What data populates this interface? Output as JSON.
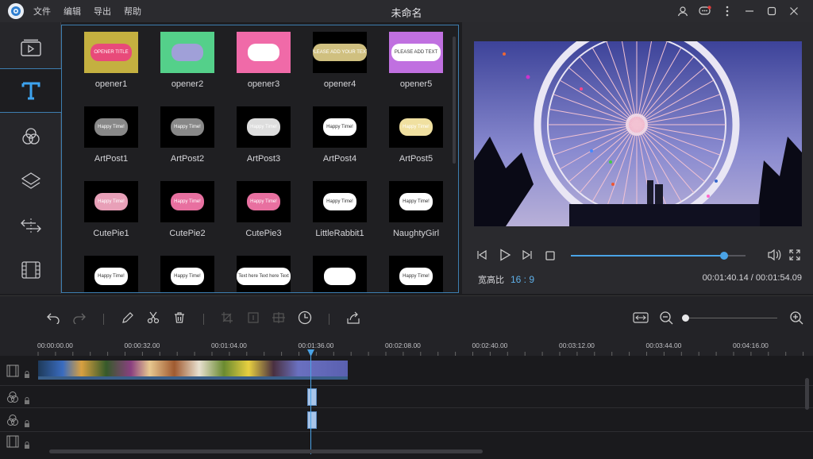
{
  "window": {
    "title": "未命名"
  },
  "menu": [
    "文件",
    "编辑",
    "导出",
    "帮助"
  ],
  "library": {
    "items": [
      {
        "label": "opener1",
        "thumb_text": "OPENER TITLE"
      },
      {
        "label": "opener2",
        "thumb_text": ""
      },
      {
        "label": "opener3",
        "thumb_text": ""
      },
      {
        "label": "opener4",
        "thumb_text": "PLEASE ADD YOUR TEXT"
      },
      {
        "label": "opener5",
        "thumb_text": "PLEASE ADD TEXT"
      },
      {
        "label": "ArtPost1",
        "thumb_text": "Happy Time!"
      },
      {
        "label": "ArtPost2",
        "thumb_text": "Happy Time!"
      },
      {
        "label": "ArtPost3",
        "thumb_text": "Happy Time!"
      },
      {
        "label": "ArtPost4",
        "thumb_text": "Happy Time!"
      },
      {
        "label": "ArtPost5",
        "thumb_text": "Happy Time!"
      },
      {
        "label": "CutePie1",
        "thumb_text": "Happy Time!"
      },
      {
        "label": "CutePie2",
        "thumb_text": "Happy Time!"
      },
      {
        "label": "CutePie3",
        "thumb_text": "Happy Time!"
      },
      {
        "label": "LittleRabbit1",
        "thumb_text": "Happy Time!"
      },
      {
        "label": "NaughtyGirl",
        "thumb_text": "Happy Time!"
      },
      {
        "label": "",
        "thumb_text": "Happy Time!"
      },
      {
        "label": "",
        "thumb_text": "Happy Time!"
      },
      {
        "label": "",
        "thumb_text": "Text here Text here Text"
      },
      {
        "label": "",
        "thumb_text": ""
      },
      {
        "label": "",
        "thumb_text": "Happy Time!"
      }
    ]
  },
  "preview": {
    "aspect_label": "宽高比",
    "aspect_value": "16 : 9",
    "current_time": "00:01:40.14",
    "total_time": "00:01:54.09",
    "progress": 0.877
  },
  "timeline": {
    "ticks": [
      "00:00:00.00",
      "00:00:32.00",
      "00:01:04.00",
      "00:01:36.00",
      "00:02:08.00",
      "00:02:40.00",
      "00:03:12.00",
      "00:03:44.00",
      "00:04:16.00"
    ]
  },
  "colors": {
    "accent": "#4aa3e6",
    "panel_border": "#3d7eb0"
  }
}
